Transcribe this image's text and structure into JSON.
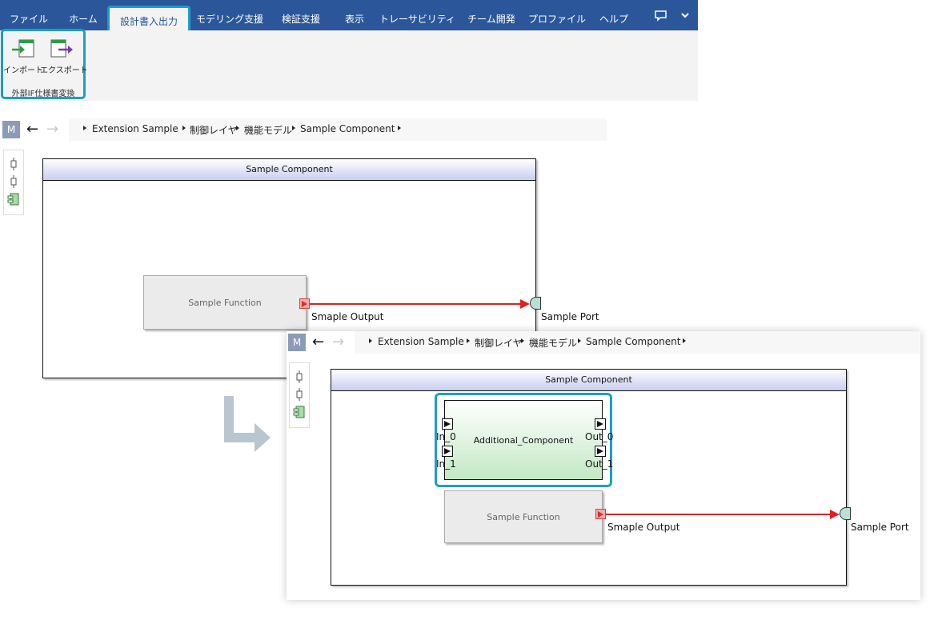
{
  "menu": {
    "items": [
      "ファイル",
      "ホーム",
      "設計書入出力",
      "モデリング支援",
      "検証支援",
      "表示",
      "トレーサビリティ",
      "チーム開発",
      "プロファイル",
      "ヘルプ"
    ],
    "active_index": 2,
    "comment_icon": "comment-icon",
    "collapse_icon": "chevron-down-icon"
  },
  "ribbon": {
    "import_label": "インポート",
    "export_label": "エクスポート",
    "group_label": "外部IF仕様書変換"
  },
  "nav": {
    "model_button": "M",
    "back_icon": "arrow-left-icon",
    "forward_icon": "arrow-right-icon",
    "breadcrumb": [
      "Extension Sample",
      "制御レイヤ",
      "機能モデル",
      "Sample Component"
    ]
  },
  "palette": {
    "icons": [
      "port-tool-icon",
      "port-tool-icon",
      "component-tool-icon"
    ]
  },
  "diagram_before": {
    "component_title": "Sample Component",
    "function_label": "Sample Function",
    "output_port_label": "Smaple Output",
    "sample_port_label": "Sample Port"
  },
  "transition_icon": "corner-arrow-icon",
  "diagram_after": {
    "component_title": "Sample Component",
    "additional_component": {
      "label": "Additional_Component",
      "inputs": [
        "In_0",
        "In_1"
      ],
      "outputs": [
        "Out_0",
        "Out_1"
      ]
    },
    "function_label": "Sample Function",
    "output_port_label": "Smaple Output",
    "sample_port_label": "Sample Port"
  },
  "colors": {
    "menubar": "#2b579a",
    "highlight": "#1b9fc6",
    "flow_line": "#e02020",
    "header_gradient_end": "#c8cdf0",
    "component_gradient_end": "#c3e8c5"
  }
}
